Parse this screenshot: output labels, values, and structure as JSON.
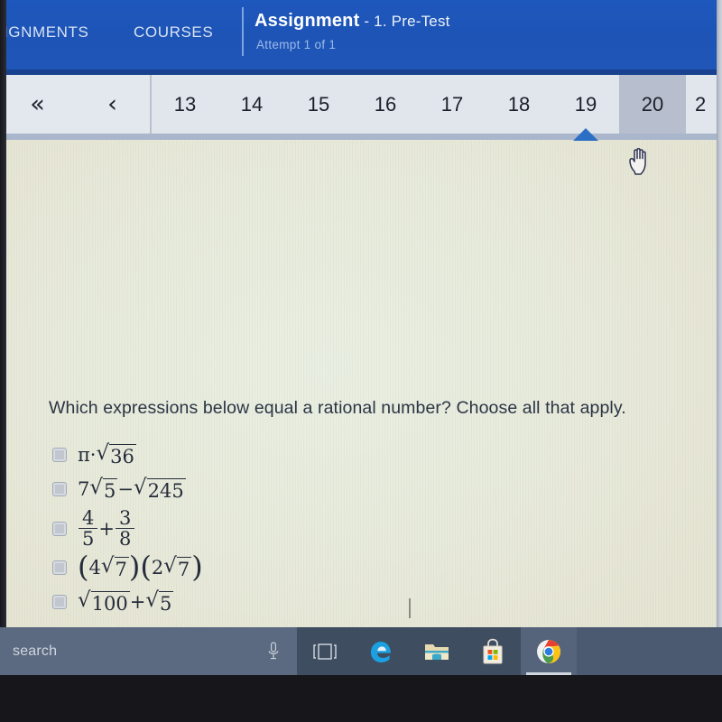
{
  "appbar": {
    "nav_assignments": "SIGNMENTS",
    "nav_courses": "COURSES",
    "title_main": "Assignment",
    "title_sub": " - 1. Pre-Test",
    "attempt": "Attempt 1 of 1",
    "bg_color": "#1e57bd"
  },
  "pager": {
    "first_arrow": "«",
    "prev_arrow": "‹",
    "pages": [
      "13",
      "14",
      "15",
      "16",
      "17",
      "18",
      "19",
      "20"
    ],
    "partial_page": "2",
    "current_page": "19",
    "hovered_page": "20",
    "marker_color": "#2d6fc4",
    "bg_color": "#dbe0e8"
  },
  "cursor": {
    "type": "pointing-hand"
  },
  "content": {
    "question": "Which expressions below equal a rational number? Choose all that apply.",
    "bg_color": "#e8eadb",
    "choices": [
      {
        "id": "choice-1",
        "checked": false,
        "plain": "π · √36",
        "parts": [
          {
            "kind": "text",
            "text": "π·"
          },
          {
            "kind": "radical",
            "radicand": "36"
          }
        ]
      },
      {
        "id": "choice-2",
        "checked": false,
        "plain": "7√5 − √245",
        "parts": [
          {
            "kind": "text",
            "text": "7"
          },
          {
            "kind": "radical",
            "radicand": "5"
          },
          {
            "kind": "text",
            "text": " − "
          },
          {
            "kind": "radical",
            "radicand": "245"
          }
        ]
      },
      {
        "id": "choice-3",
        "checked": false,
        "plain": "4/5 + 3/8",
        "parts": [
          {
            "kind": "fraction",
            "num": "4",
            "den": "5"
          },
          {
            "kind": "text",
            "text": "+"
          },
          {
            "kind": "fraction",
            "num": "3",
            "den": "8"
          }
        ]
      },
      {
        "id": "choice-4",
        "checked": false,
        "plain": "(4√7)(2√7)",
        "parts": [
          {
            "kind": "paren",
            "text": "("
          },
          {
            "kind": "text",
            "text": "4"
          },
          {
            "kind": "radical",
            "radicand": "7"
          },
          {
            "kind": "paren",
            "text": ")"
          },
          {
            "kind": "paren",
            "text": "("
          },
          {
            "kind": "text",
            "text": "2"
          },
          {
            "kind": "radical",
            "radicand": "7"
          },
          {
            "kind": "paren",
            "text": ")"
          }
        ]
      },
      {
        "id": "choice-5",
        "checked": false,
        "plain": "√100 + √5",
        "parts": [
          {
            "kind": "radical",
            "radicand": "100"
          },
          {
            "kind": "text",
            "text": " + "
          },
          {
            "kind": "radical",
            "radicand": "5"
          }
        ]
      }
    ]
  },
  "taskbar": {
    "search_placeholder": "search",
    "items": [
      {
        "name": "cortana-mic-icon",
        "label": "Cortana"
      },
      {
        "name": "task-view-icon",
        "label": "Task View"
      },
      {
        "name": "edge-icon",
        "label": "Microsoft Edge"
      },
      {
        "name": "file-explorer-icon",
        "label": "File Explorer"
      },
      {
        "name": "microsoft-store-icon",
        "label": "Microsoft Store"
      },
      {
        "name": "chrome-icon",
        "label": "Google Chrome"
      }
    ],
    "active_item": "chrome-icon",
    "bg_color": "#4b5a70"
  }
}
